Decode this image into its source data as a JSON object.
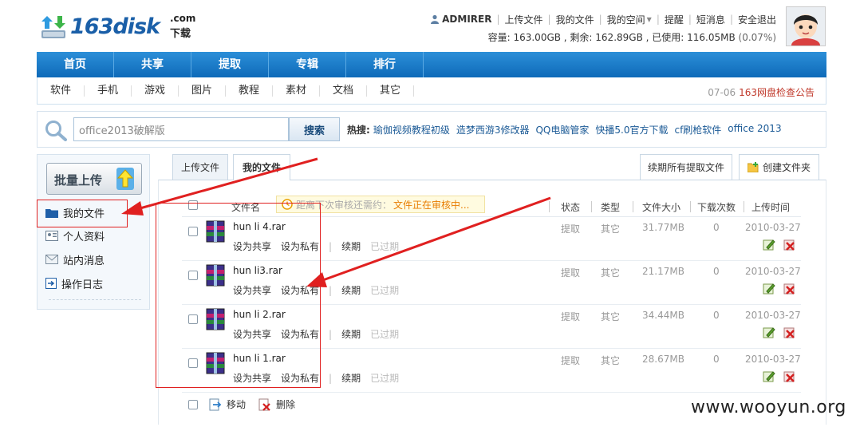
{
  "header": {
    "logo_main": "163disk",
    "logo_com": ".com",
    "logo_sub": "下载",
    "username": "ADMIRER",
    "top_links": [
      "上传文件",
      "我的文件",
      "我的空间",
      "提醒",
      "短消息",
      "安全退出"
    ],
    "quota_text": "容量: 163.00GB , 剩余: 162.89GB , 已使用: 116.05MB",
    "quota_pct": "(0.07%)"
  },
  "main_nav": [
    "首页",
    "共享",
    "提取",
    "专辑",
    "排行"
  ],
  "sub_nav": [
    "软件",
    "手机",
    "游戏",
    "图片",
    "教程",
    "素材",
    "文档",
    "其它"
  ],
  "notice": {
    "date": "07-06",
    "text": "163网盘检查公告"
  },
  "search": {
    "value": "office2013破解版",
    "button": "搜索",
    "hot_label": "热搜:",
    "hot_terms": [
      "瑜伽视频教程初级",
      "造梦西游3修改器",
      "QQ电脑管家",
      "快播5.0官方下载",
      "cf刷枪软件",
      "office 2013"
    ]
  },
  "sidebar": {
    "batch_upload": "批量上传",
    "items": [
      "我的文件",
      "个人资料",
      "站内消息",
      "操作日志"
    ]
  },
  "tabs": {
    "upload": "上传文件",
    "my_files": "我的文件",
    "renew_all": "续期所有提取文件",
    "new_folder": "创建文件夹"
  },
  "table": {
    "headers": {
      "name": "文件名",
      "status": "状态",
      "type": "类型",
      "size": "文件大小",
      "downloads": "下载次数",
      "date": "上传时间"
    },
    "warning_label": "距离下次审核还需约：",
    "warning_value": "文件正在审核中...",
    "action_share": "设为共享",
    "action_private": "设为私有",
    "action_renew": "续期",
    "action_expired": "已过期",
    "rows": [
      {
        "name": "hun li 4.rar",
        "status": "提取",
        "type": "其它",
        "size": "31.77MB",
        "downloads": "0",
        "date": "2010-03-27"
      },
      {
        "name": "hun li3.rar",
        "status": "提取",
        "type": "其它",
        "size": "21.17MB",
        "downloads": "0",
        "date": "2010-03-27"
      },
      {
        "name": "hun li 2.rar",
        "status": "提取",
        "type": "其它",
        "size": "34.44MB",
        "downloads": "0",
        "date": "2010-03-27"
      },
      {
        "name": "hun li 1.rar",
        "status": "提取",
        "type": "其它",
        "size": "28.67MB",
        "downloads": "0",
        "date": "2010-03-27"
      }
    ]
  },
  "footer": {
    "move": "移动",
    "delete": "删除"
  },
  "watermark": "www.wooyun.org",
  "colors": {
    "brand_blue": "#1a6fbf",
    "annotation_red": "#e02020",
    "notice_red": "#c0392b",
    "warn_orange": "#e87d00"
  }
}
